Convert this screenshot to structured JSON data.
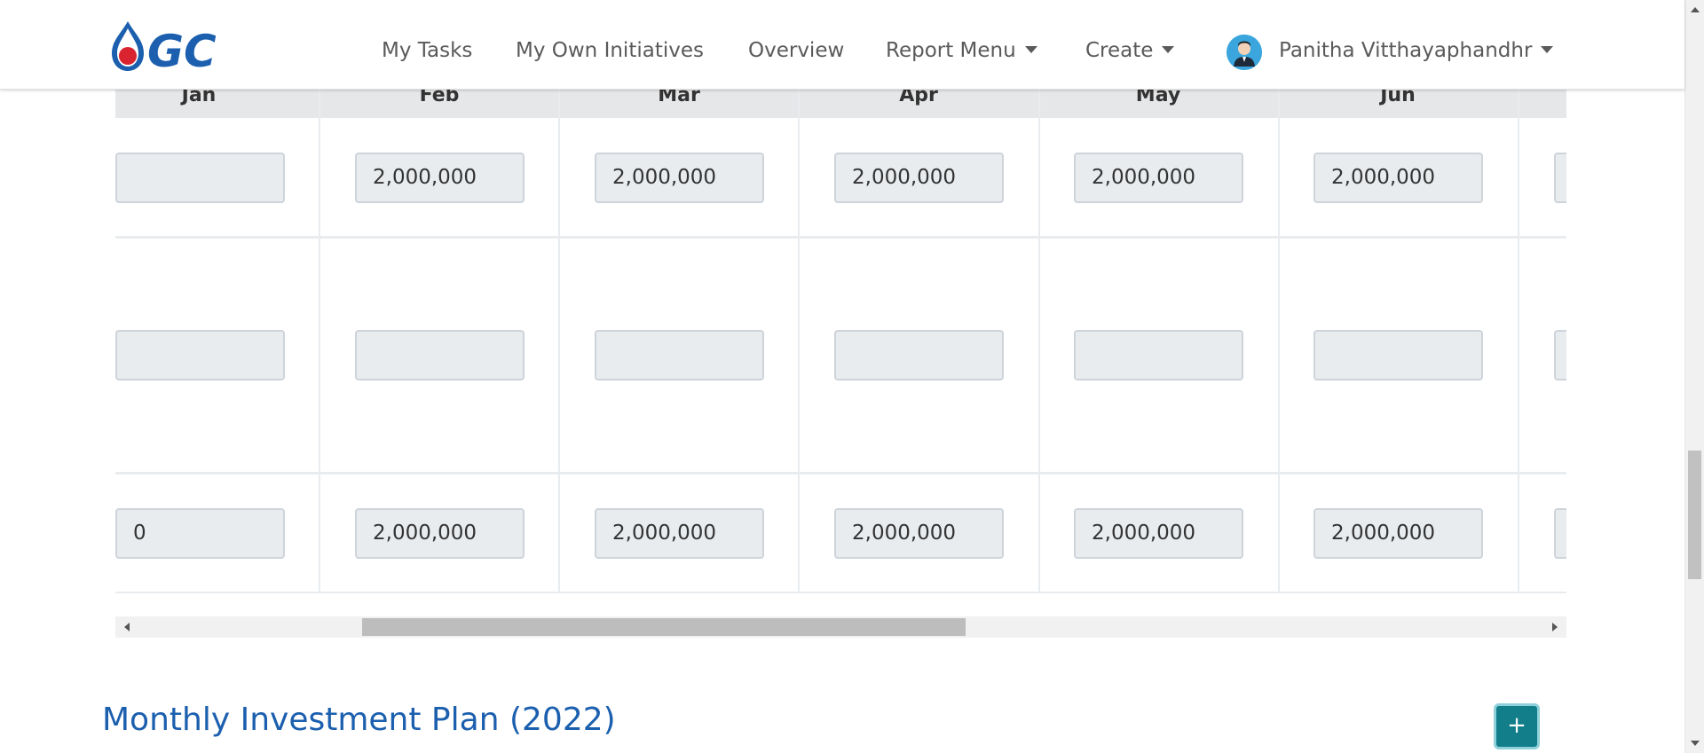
{
  "colors": {
    "brand_blue": "#1b5fae",
    "logo_red": "#d9232e",
    "add_button_bg": "#127e8a",
    "input_bg": "#e9ecef"
  },
  "navbar": {
    "logo_icon": "gc-logo-icon",
    "logo_text": "GC",
    "items": [
      {
        "label": "My Tasks"
      },
      {
        "label": "My Own Initiatives"
      },
      {
        "label": "Overview"
      },
      {
        "label": "Report Menu",
        "dropdown": true
      },
      {
        "label": "Create",
        "dropdown": true
      }
    ],
    "user": {
      "name": "Panitha Vitthayaphandhr",
      "avatar_icon": "user-avatar-icon"
    }
  },
  "table": {
    "header_labels": [
      "Jan",
      "Feb",
      "Mar",
      "Apr",
      "May",
      "Jun"
    ],
    "rows": [
      [
        "",
        "2,000,000",
        "2,000,000",
        "2,000,000",
        "2,000,000",
        "2,000,000"
      ],
      [
        "",
        "",
        "",
        "",
        "",
        ""
      ],
      [
        "0",
        "2,000,000",
        "2,000,000",
        "2,000,000",
        "2,000,000",
        "2,000,000"
      ]
    ]
  },
  "section": {
    "title": "Monthly Investment Plan (2022)",
    "add_button_label": "+"
  }
}
